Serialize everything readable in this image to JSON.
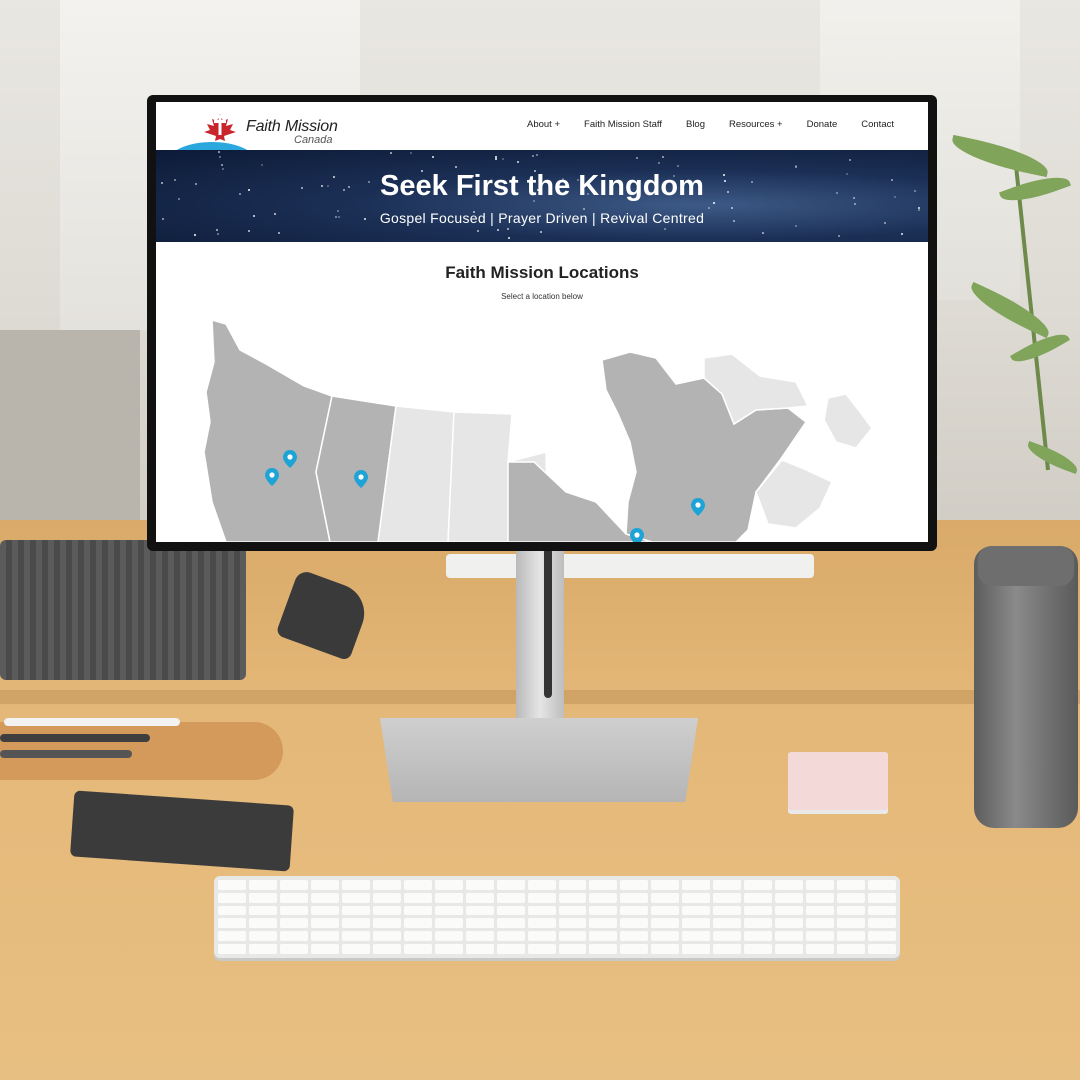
{
  "site": {
    "logo": {
      "title": "Faith Mission",
      "subtitle": "Canada"
    },
    "nav": [
      {
        "label": "About +"
      },
      {
        "label": "Faith Mission Staff"
      },
      {
        "label": "Blog"
      },
      {
        "label": "Resources +"
      },
      {
        "label": "Donate"
      },
      {
        "label": "Contact"
      }
    ]
  },
  "hero": {
    "title": "Seek First the Kingdom",
    "subtitle": "Gospel Focused | Prayer Driven | Revival Centred"
  },
  "locations": {
    "title": "Faith Mission Locations",
    "subtitle": "Select a location below"
  },
  "colors": {
    "accent": "#2aa7dd",
    "logo_leaf": "#c8262c",
    "map_selectable": "#b3b3b3",
    "map_other": "#e6e6e6",
    "pin": "#1ea3d6"
  },
  "icons": {
    "logo": "maple-leaf-cross-icon",
    "pin": "map-pin-icon"
  }
}
